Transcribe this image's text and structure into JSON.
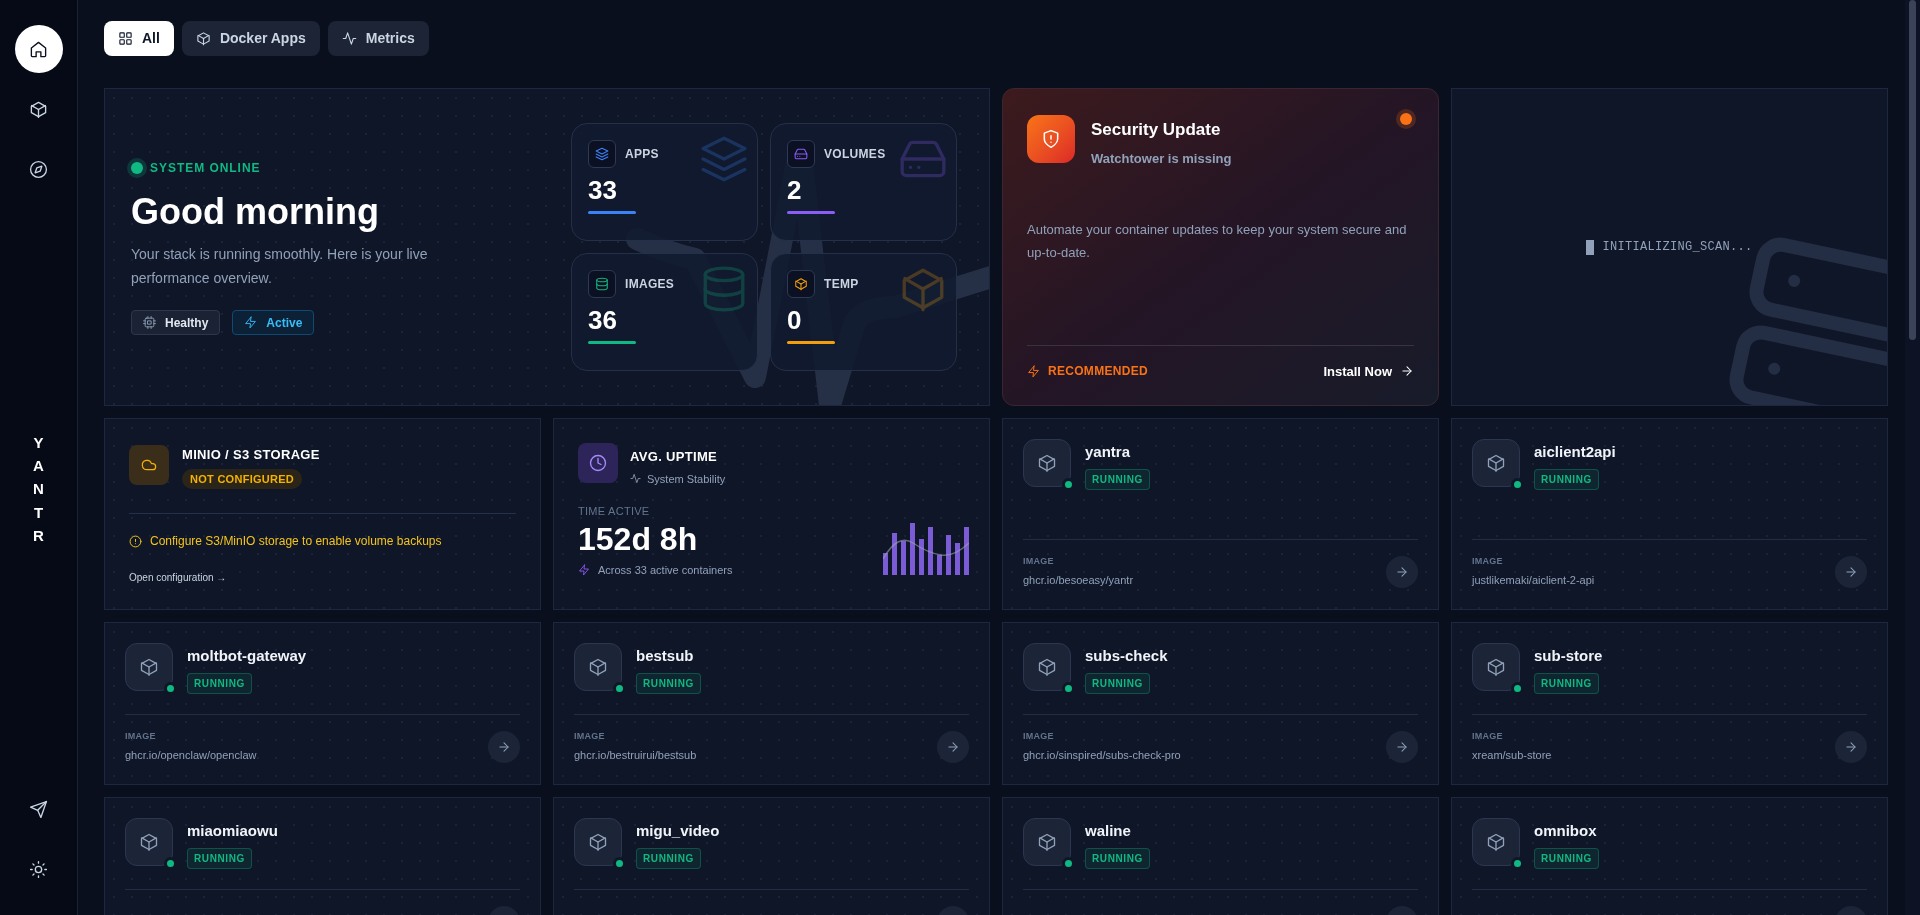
{
  "sidebar": {
    "items": [
      {
        "selected": true
      },
      {
        "selected": false
      },
      {
        "selected": false
      }
    ],
    "brand": "YANTR",
    "bottom_items": [
      {
        "selected": false
      },
      {
        "selected": false
      }
    ]
  },
  "tabs": [
    {
      "label": "All",
      "selected": true
    },
    {
      "label": "Docker Apps",
      "selected": false
    },
    {
      "label": "Metrics",
      "selected": false
    }
  ],
  "hero": {
    "status": "SYSTEM ONLINE",
    "title": "Good morning",
    "subtitle": "Your stack is running smoothly. Here is your live performance overview.",
    "badges": [
      "Healthy",
      "Active"
    ],
    "stats": [
      {
        "label": "APPS",
        "value": "33",
        "color": "#3b82f6"
      },
      {
        "label": "VOLUMES",
        "value": "2",
        "color": "#8b5cf6"
      },
      {
        "label": "IMAGES",
        "value": "36",
        "color": "#10b981"
      },
      {
        "label": "TEMP",
        "value": "0",
        "color": "#f59e0b"
      }
    ]
  },
  "security": {
    "title": "Security Update",
    "subtitle": "Watchtower is missing",
    "body": "Automate your container updates to keep your system secure and up-to-date.",
    "tag": "RECOMMENDED",
    "action": "Install Now"
  },
  "scan": {
    "text": "INITIALIZING_SCAN..."
  },
  "storage": {
    "title": "MINIO / S3 STORAGE",
    "badge": "NOT CONFIGURED",
    "warning": "Configure S3/MinIO storage to enable volume backups",
    "link": "Open configuration →"
  },
  "uptime": {
    "title": "AVG. UPTIME",
    "subtitle": "System Stability",
    "label": "TIME ACTIVE",
    "value": "152d 8h",
    "note": "Across 33 active containers"
  },
  "apps": [
    {
      "name": "yantra",
      "status": "RUNNING",
      "running": true,
      "image_label": "IMAGE",
      "image": "ghcr.io/besoeasy/yantr"
    },
    {
      "name": "aiclient2api",
      "status": "RUNNING",
      "running": true,
      "image_label": "IMAGE",
      "image": "justlikemaki/aiclient-2-api"
    },
    {
      "name": "moltbot-gateway",
      "status": "RUNNING",
      "running": true,
      "image_label": "IMAGE",
      "image": "ghcr.io/openclaw/openclaw"
    },
    {
      "name": "bestsub",
      "status": "RUNNING",
      "running": true,
      "image_label": "IMAGE",
      "image": "ghcr.io/bestruirui/bestsub"
    },
    {
      "name": "subs-check",
      "status": "RUNNING",
      "running": true,
      "image_label": "IMAGE",
      "image": "ghcr.io/sinspired/subs-check-pro"
    },
    {
      "name": "sub-store",
      "status": "RUNNING",
      "running": true,
      "image_label": "IMAGE",
      "image": "xream/sub-store"
    },
    {
      "name": "miaomiaowu",
      "status": "RUNNING",
      "running": true
    },
    {
      "name": "migu_video",
      "status": "RUNNING",
      "running": true
    },
    {
      "name": "waline",
      "status": "RUNNING",
      "running": true
    },
    {
      "name": "omnibox",
      "status": "RUNNING",
      "running": true
    }
  ]
}
